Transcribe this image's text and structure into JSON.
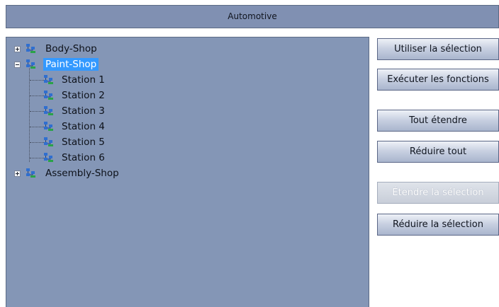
{
  "header": {
    "title": "Automotive"
  },
  "tree": {
    "nodes": [
      {
        "label": "Body-Shop",
        "expanded": false,
        "selected": false
      },
      {
        "label": "Paint-Shop",
        "expanded": true,
        "selected": true,
        "children": [
          "Station 1",
          "Station 2",
          "Station 3",
          "Station 4",
          "Station 5",
          "Station 6"
        ]
      },
      {
        "label": "Assembly-Shop",
        "expanded": false,
        "selected": false
      }
    ]
  },
  "buttons": {
    "use_selection": "Utiliser la sélection",
    "run_functions": "Exécuter les fonctions",
    "expand_all": "Tout étendre",
    "collapse_all": "Réduire tout",
    "expand_selection": "Étendre la sélection",
    "collapse_selection": "Réduire la sélection"
  },
  "colors": {
    "panel_background": "#8496b6",
    "title_background": "#8090b2",
    "selection_highlight": "#3399ff"
  },
  "icons": {
    "node": "network-node-icon",
    "expand": "plus-box-icon",
    "collapse": "minus-box-icon"
  }
}
